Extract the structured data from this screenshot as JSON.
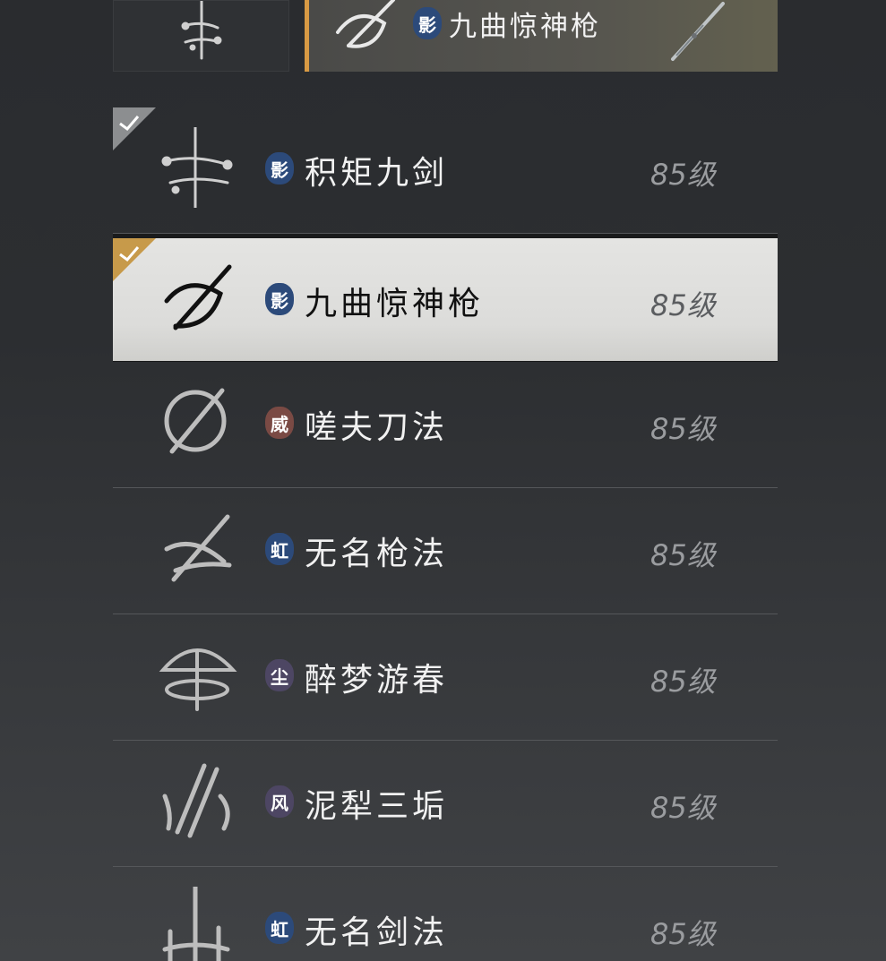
{
  "top_bar": {
    "selected_name": "九曲惊神枪",
    "selected_badge": "影"
  },
  "skills": [
    {
      "name": "积矩九剑",
      "badge": "影",
      "level": "85级"
    },
    {
      "name": "九曲惊神枪",
      "badge": "影",
      "level": "85级"
    },
    {
      "name": "嗟夫刀法",
      "badge": "威",
      "level": "85级"
    },
    {
      "name": "无名枪法",
      "badge": "虹",
      "level": "85级"
    },
    {
      "name": "醉梦游春",
      "badge": "尘",
      "level": "85级"
    },
    {
      "name": "泥犁三垢",
      "badge": "风",
      "level": "85级"
    },
    {
      "name": "无名剑法",
      "badge": "虹",
      "level": "85级"
    }
  ],
  "colors": {
    "accent_gold": "#d89a44",
    "badge_ying": "#2c4a7a",
    "badge_wei": "#7a4a44",
    "badge_hong": "#2c4a7a",
    "badge_chen": "#4d4663",
    "badge_feng": "#4d4663"
  },
  "icons": {
    "top_slot": "sword-rune-icon",
    "selected": "spear-swirl-icon",
    "weapon": "spear-weapon-icon"
  }
}
